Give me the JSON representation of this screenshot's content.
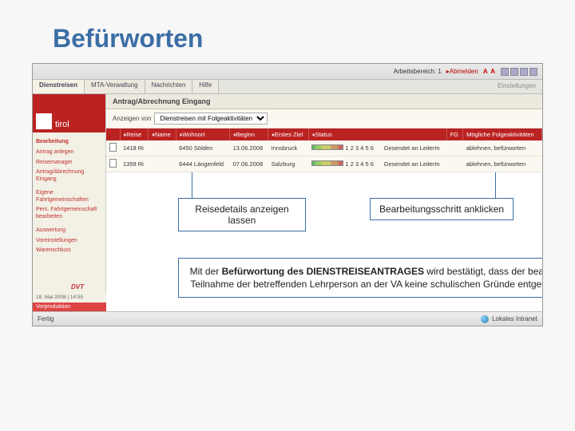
{
  "slide": {
    "title": "Befürworten"
  },
  "top": {
    "workspace": "Arbeitsbereich: 1",
    "logout": "▸Abmelden",
    "aa": "A A"
  },
  "tabs": [
    "Dienstreisen",
    "MTA-Verwaltung",
    "Nachrichten",
    "Hilfe"
  ],
  "tabs_right": "Einstellungen",
  "logo_text": "tirol",
  "nav": [
    "Bearbeitung",
    "Antrag anlegen",
    "Reisemanager",
    "Antrag/Abrechnung Eingang",
    "Eigene Fahrtgemeinschaften",
    "Pers. Fahrtgemeinschaft bearbeiten",
    "Auswertung",
    "Voreinstellungen",
    "Warenschluss"
  ],
  "main_heading": "Antrag/Abrechnung Eingang",
  "filter": {
    "label": "Anzeigen von",
    "value": "Dienstreisen mit Folgeaktivitäten"
  },
  "columns": [
    "",
    "Reise",
    "Name",
    "Wohnort",
    "Beginn",
    "Erstes Ziel",
    "Status",
    "FG",
    "Mögliche Folgeaktivitäten"
  ],
  "rows": [
    {
      "reise": "1418 Ri",
      "name": "",
      "wohnort": "6450 Sölden",
      "beginn": "13.06.2008",
      "ziel": "Innsbruck",
      "status": "1 2 3 4 5 6",
      "status2": "Gesendet an LeiterIn",
      "fg": "",
      "action": "ablehnen, befürworten"
    },
    {
      "reise": "1359 Ri",
      "name": "",
      "wohnort": "6444 Längenfeld",
      "beginn": "07.06.2008",
      "ziel": "Salzburg",
      "status": "1 2 3 4 5 6",
      "status2": "Gesendet an LeiterIn",
      "fg": "",
      "action": "ablehnen, befürworten"
    }
  ],
  "callouts": {
    "c1": "Reisedetails anzeigen lassen",
    "c2": "Bearbeitungsschritt anklicken"
  },
  "infobox_html": "Mit der <b>Befürwortung des DIENSTREISEANTRAGES</b> wird bestätigt, dass der beabsichtigten Teilnahme der betreffenden Lehrperson an der VA keine schulischen Gründe entgegenstehen.",
  "status": {
    "done": "Fertig",
    "zone": "Lokales Intranet"
  },
  "vorproduktion": "Vorproduktion",
  "bottom_info": "18. Mai 2008 | 14:55",
  "dvt": "DVT",
  "chart_data": null
}
